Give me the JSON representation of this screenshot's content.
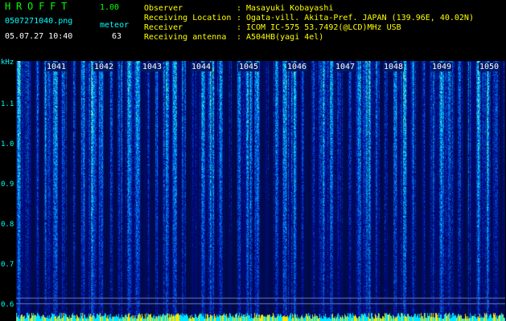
{
  "header": {
    "app_title": "HROFFT",
    "version": "1.00",
    "filename": "0507271040.png",
    "datetime": "05.07.27 10:40",
    "mode_label": "meteor",
    "count": "63"
  },
  "info": {
    "rows": [
      {
        "label": "Observer",
        "value": "Masayuki Kobayashi"
      },
      {
        "label": "Receiving Location",
        "value": "Ogata-vill. Akita-Pref. JAPAN (139.96E, 40.02N)"
      },
      {
        "label": "Receiver",
        "value": "ICOM IC-575 53.7492(@LCD)MHz USB"
      },
      {
        "label": "Receiving antenna",
        "value": "A504HB(yagi 4el)"
      }
    ],
    "separator": ":"
  },
  "spectrogram": {
    "unit_label": "kHz",
    "y_ticks": [
      "1.1",
      "1.0",
      "0.9",
      "0.8",
      "0.7",
      "0.6"
    ],
    "minute_labels": [
      "1041",
      "1042",
      "1043",
      "1044",
      "1045",
      "1046",
      "1047",
      "1048",
      "1049",
      "1050"
    ],
    "colors": {
      "background": "#000000",
      "low": "#00186e",
      "mid": "#0050ff",
      "high": "#00ffff",
      "peak": "#ffff00",
      "axis_text": "#00ffff",
      "header_green": "#00ff00",
      "header_yellow": "#ffff00"
    }
  }
}
